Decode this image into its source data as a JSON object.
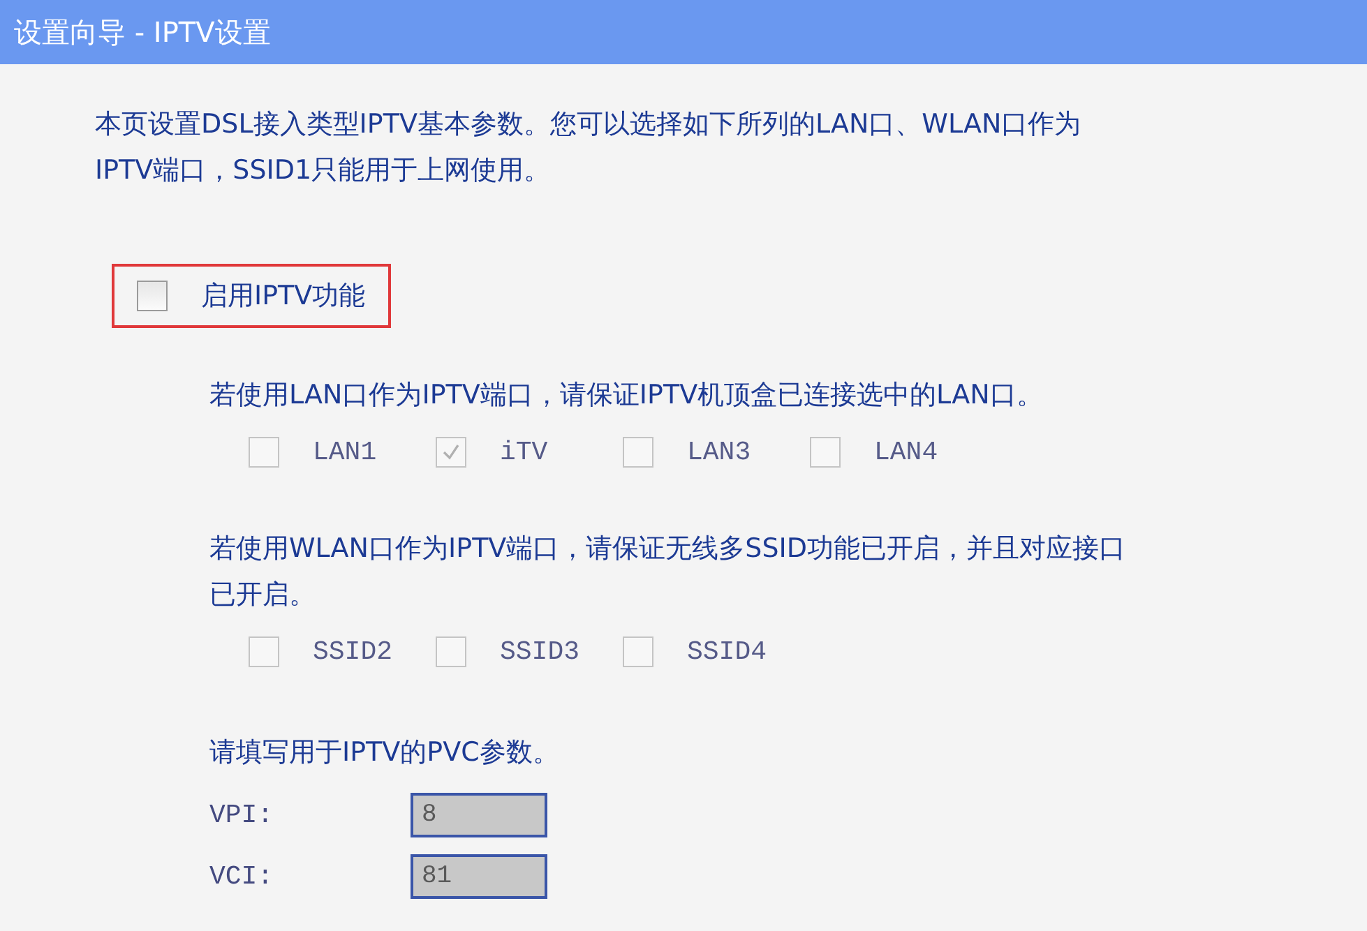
{
  "window": {
    "title": "设置向导 - IPTV设置"
  },
  "intro": {
    "lines": [
      "本页设置DSL接入类型IPTV基本参数。您可以选择如下所列的LAN口、WLAN口作为",
      "IPTV端口，SSID1只能用于上网使用。"
    ]
  },
  "enable_iptv": {
    "label": "启用IPTV功能",
    "checked": false,
    "highlighted": true
  },
  "lan_section": {
    "lines": [
      "若使用LAN口作为IPTV端口，请保证IPTV机顶盒已连接选中的LAN口。"
    ],
    "ports": [
      {
        "label": "LAN1",
        "checked": false,
        "disabled": true
      },
      {
        "label": "iTV",
        "checked": true,
        "disabled": true
      },
      {
        "label": "LAN3",
        "checked": false,
        "disabled": true
      },
      {
        "label": "LAN4",
        "checked": false,
        "disabled": true
      }
    ]
  },
  "wlan_section": {
    "lines": [
      "若使用WLAN口作为IPTV端口，请保证无线多SSID功能已开启，并且对应接口",
      "已开启。"
    ],
    "ports": [
      {
        "label": "SSID2",
        "checked": false,
        "disabled": true
      },
      {
        "label": "SSID3",
        "checked": false,
        "disabled": true
      },
      {
        "label": "SSID4",
        "checked": false,
        "disabled": true
      }
    ]
  },
  "pvc": {
    "text": "请填写用于IPTV的PVC参数。",
    "fields": [
      {
        "label": "VPI:",
        "value": "8",
        "disabled": true
      },
      {
        "label": "VCI:",
        "value": "81",
        "disabled": true
      }
    ]
  }
}
